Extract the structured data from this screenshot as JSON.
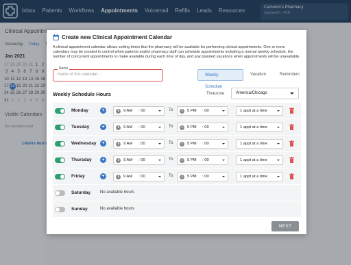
{
  "nav": {
    "items": [
      "Inbox",
      "Patients",
      "Workflows",
      "Appointments",
      "Voicemail",
      "Refills",
      "Leads",
      "Resources"
    ],
    "active": "Appointments"
  },
  "pharmacy": {
    "name": "Cameron's Pharmacy",
    "location": "Carlsworth · 4CH"
  },
  "sidebar": {
    "title": "Clinical Appointme",
    "yesterday": "Yesterday",
    "today": "Today",
    "tomorrow": "T",
    "month": "Jan 2021",
    "weeks": [
      [
        "27",
        "28",
        "29",
        "30",
        "31",
        "1",
        "2"
      ],
      [
        "3",
        "4",
        "5",
        "6",
        "7",
        "8",
        "9"
      ],
      [
        "10",
        "11",
        "12",
        "13",
        "14",
        "15",
        "16"
      ],
      [
        "17",
        "18",
        "19",
        "20",
        "21",
        "22",
        "23"
      ],
      [
        "24",
        "25",
        "26",
        "27",
        "28",
        "29",
        "30"
      ],
      [
        "31",
        "1",
        "2",
        "3",
        "4",
        "5",
        "6"
      ]
    ],
    "selected_day": "18",
    "visible_calendars": "Visible Calendars",
    "no_calendars": "No calendars avail",
    "create_new": "CREATE NEW C"
  },
  "modal": {
    "title": "Create new Clinical Appointment Calendar",
    "description": "A clinical appointment calendar allows setting times that the pharmacy will be available for performing clinical appointments.  One or more calendars may be created to control when patients and/or pharmacy staff can schedule appointments including a normal weekly schedule, the number of concurrent appointments to make available during each time of day, and any planned vacations when appointments will be unavailable.",
    "name_label": "Name",
    "name_placeholder": "Name of this calendar...",
    "tabs": [
      "Weekly Schedule",
      "Vacation",
      "Reminders"
    ],
    "active_tab": "Weekly Schedule",
    "weekly_title": "Weekly Schedule Hours",
    "timezone_label": "Timezone",
    "timezone_value": "America/Chicago",
    "to_label": "To",
    "days": [
      {
        "day": "Monday",
        "enabled": true,
        "start_hour": "9 AM",
        "start_min": ": 00",
        "end_hour": "5 PM",
        "end_min": ": 00",
        "appts": "1 appt at a time"
      },
      {
        "day": "Tuesday",
        "enabled": true,
        "start_hour": "9 AM",
        "start_min": ": 00",
        "end_hour": "5 PM",
        "end_min": ": 00",
        "appts": "1 appt at a time"
      },
      {
        "day": "Wednesday",
        "enabled": true,
        "start_hour": "9 AM",
        "start_min": ": 00",
        "end_hour": "5 PM",
        "end_min": ": 00",
        "appts": "1 appt at a time"
      },
      {
        "day": "Thursday",
        "enabled": true,
        "start_hour": "9 AM",
        "start_min": ": 00",
        "end_hour": "5 PM",
        "end_min": ": 00",
        "appts": "1 appt at a time"
      },
      {
        "day": "Friday",
        "enabled": true,
        "start_hour": "9 AM",
        "start_min": ": 00",
        "end_hour": "5 PM",
        "end_min": ": 00",
        "appts": "1 appt at a time"
      },
      {
        "day": "Saturday",
        "enabled": false,
        "none": "No available hours"
      },
      {
        "day": "Sunday",
        "enabled": false,
        "none": "No available hours"
      }
    ],
    "next_label": "NEXT"
  },
  "colors": {
    "topbar": "#1e3a5a",
    "accent": "#3a76c4",
    "toggle_on": "#2e9e6e",
    "toggle_off": "#bbbbbb",
    "danger": "#d9534f",
    "next_button": "#8a8f94"
  },
  "icons": {
    "logo": "pharmacy-logo-icon",
    "calendar": "calendar-icon",
    "add": "plus-circle-icon",
    "clock": "clock-icon",
    "trash": "trash-icon",
    "caret": "chevron-down-icon"
  }
}
